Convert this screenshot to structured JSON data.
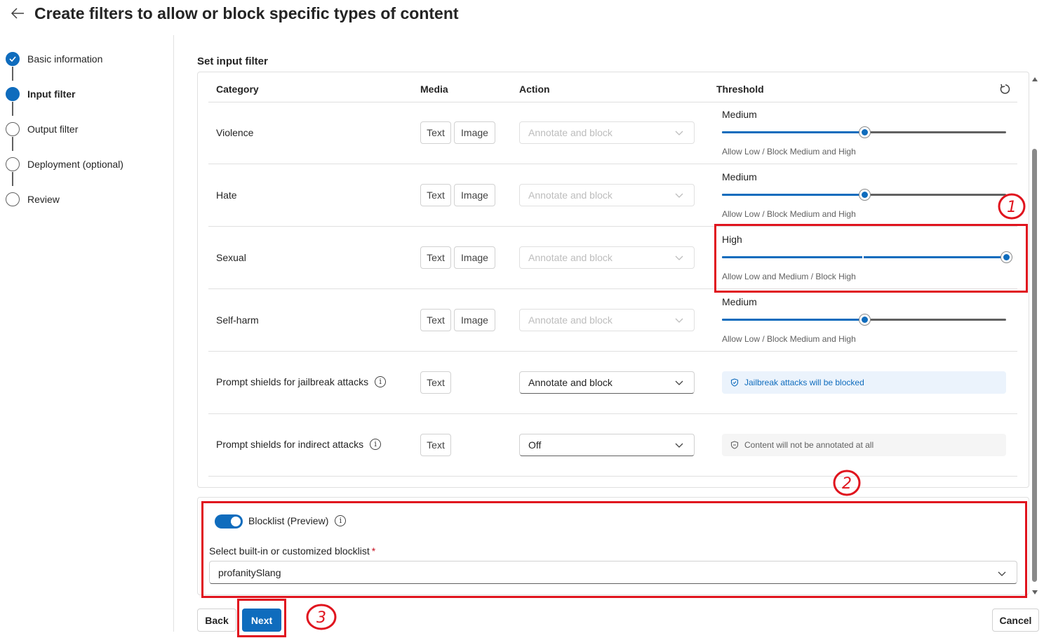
{
  "page": {
    "title": "Create filters to allow or block specific types of content"
  },
  "steps": [
    {
      "label": "Basic information",
      "state": "done"
    },
    {
      "label": "Input filter",
      "state": "active"
    },
    {
      "label": "Output filter",
      "state": "pending"
    },
    {
      "label": "Deployment (optional)",
      "state": "pending"
    },
    {
      "label": "Review",
      "state": "pending"
    }
  ],
  "section": {
    "title": "Set input filter"
  },
  "table": {
    "headers": {
      "category": "Category",
      "media": "Media",
      "action": "Action",
      "threshold": "Threshold"
    },
    "rows": [
      {
        "category": "Violence",
        "media": [
          "Text",
          "Image"
        ],
        "action": "Annotate and block",
        "action_enabled": false,
        "threshold_label": "Medium",
        "threshold_level": 0.5,
        "threshold_desc": "Allow Low / Block Medium and High"
      },
      {
        "category": "Hate",
        "media": [
          "Text",
          "Image"
        ],
        "action": "Annotate and block",
        "action_enabled": false,
        "threshold_label": "Medium",
        "threshold_level": 0.5,
        "threshold_desc": "Allow Low / Block Medium and High"
      },
      {
        "category": "Sexual",
        "media": [
          "Text",
          "Image"
        ],
        "action": "Annotate and block",
        "action_enabled": false,
        "threshold_label": "High",
        "threshold_level": 1.0,
        "threshold_desc": "Allow Low and Medium / Block High"
      },
      {
        "category": "Self-harm",
        "media": [
          "Text",
          "Image"
        ],
        "action": "Annotate and block",
        "action_enabled": false,
        "threshold_label": "Medium",
        "threshold_level": 0.5,
        "threshold_desc": "Allow Low / Block Medium and High"
      },
      {
        "category": "Prompt shields for jailbreak attacks",
        "media": [
          "Text"
        ],
        "action": "Annotate and block",
        "action_enabled": true,
        "message": "Jailbreak attacks will be blocked",
        "message_type": "info"
      },
      {
        "category": "Prompt shields for indirect attacks",
        "media": [
          "Text"
        ],
        "action": "Off",
        "action_enabled": true,
        "message": "Content will not be annotated at all",
        "message_type": "neutral"
      }
    ]
  },
  "blocklist": {
    "toggle_label": "Blocklist (Preview)",
    "toggle_on": true,
    "field_label": "Select built-in or customized blocklist",
    "required_mark": "*",
    "selected": "profanitySlang"
  },
  "footer": {
    "back_label": "Back",
    "next_label": "Next",
    "cancel_label": "Cancel"
  },
  "annotations": {
    "one": "1",
    "two": "2",
    "three": "3"
  },
  "colors": {
    "accent": "#0f6cbd",
    "annotation_red": "#e0141e"
  }
}
